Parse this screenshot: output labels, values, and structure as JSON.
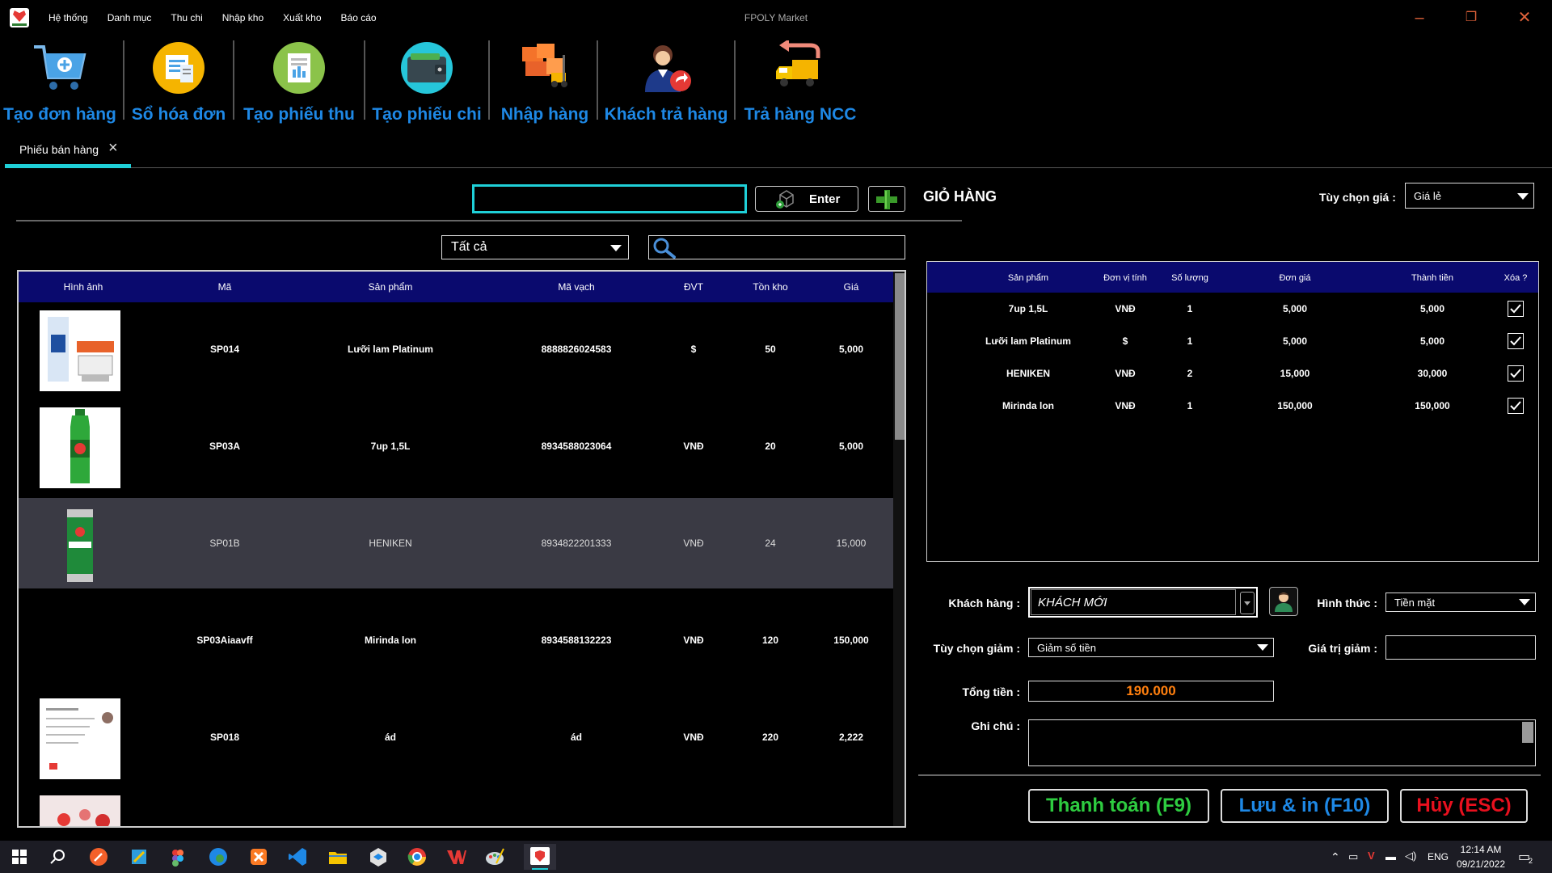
{
  "menu": [
    "Hệ thống",
    "Danh mục",
    "Thu chi",
    "Nhập kho",
    "Xuất kho",
    "Báo cáo"
  ],
  "window_title": "FPOLY Market",
  "window_controls": {
    "minimize": "–",
    "restore": "❐",
    "close": "✕"
  },
  "ribbon": {
    "create_order": "Tạo đơn hàng",
    "invoice_book": "Sổ hóa đơn",
    "create_receipt": "Tạo phiếu thu",
    "create_payment": "Tạo phiếu chi",
    "import_goods": "Nhập hàng",
    "customer_return": "Khách trả hàng",
    "supplier_return": "Trả hàng NCC"
  },
  "tab": {
    "label": "Phiếu bán hàng"
  },
  "barcode": {
    "value": "",
    "enter_label": "Enter"
  },
  "filter": {
    "category": "Tất cả",
    "search_value": ""
  },
  "product_table": {
    "headers": {
      "image": "Hình ảnh",
      "code": "Mã",
      "product": "Sản phẩm",
      "barcode": "Mã vạch",
      "unit": "ĐVT",
      "stock": "Tồn kho",
      "price": "Giá"
    },
    "rows": [
      {
        "code": "SP014",
        "product": "Lưỡi lam Platinum",
        "barcode": "8888826024583",
        "unit": "$",
        "stock": "50",
        "price": "5,000"
      },
      {
        "code": "SP03A",
        "product": "7up 1,5L",
        "barcode": "8934588023064",
        "unit": "VNĐ",
        "stock": "20",
        "price": "5,000"
      },
      {
        "code": "SP01B",
        "product": "HENIKEN",
        "barcode": "8934822201333",
        "unit": "VNĐ",
        "stock": "24",
        "price": "15,000"
      },
      {
        "code": "SP03Aiaavff",
        "product": "Mirinda lon",
        "barcode": "8934588132223",
        "unit": "VNĐ",
        "stock": "120",
        "price": "150,000"
      },
      {
        "code": "SP018",
        "product": "ád",
        "barcode": "ád",
        "unit": "VNĐ",
        "stock": "220",
        "price": "2,222"
      }
    ]
  },
  "cart": {
    "title": "GIỎ HÀNG",
    "price_option_label": "Tùy chọn giá :",
    "price_option": "Giá lẻ",
    "headers": {
      "product": "Sản phẩm",
      "unit": "Đơn vị tính",
      "qty": "Số lượng",
      "unit_price": "Đơn giá",
      "total": "Thành tiền",
      "delete": "Xóa ?"
    },
    "rows": [
      {
        "product": "7up 1,5L",
        "unit": "VNĐ",
        "qty": "1",
        "unit_price": "5,000",
        "total": "5,000"
      },
      {
        "product": "Lưỡi lam Platinum",
        "unit": "$",
        "qty": "1",
        "unit_price": "5,000",
        "total": "5,000"
      },
      {
        "product": "HENIKEN",
        "unit": "VNĐ",
        "qty": "2",
        "unit_price": "15,000",
        "total": "30,000"
      },
      {
        "product": "Mirinda lon",
        "unit": "VNĐ",
        "qty": "1",
        "unit_price": "150,000",
        "total": "150,000"
      }
    ]
  },
  "form": {
    "customer_label": "Khách hàng :",
    "customer_value": "KHÁCH MỚI",
    "payment_method_label": "Hình thức :",
    "payment_method": "Tiền mặt",
    "discount_option_label": "Tùy chọn giảm :",
    "discount_option": "Giảm số tiền",
    "discount_value_label": "Giá trị giảm :",
    "discount_value": "",
    "total_label": "Tổng tiền :",
    "total_value": "190.000",
    "note_label": "Ghi chú :",
    "note_value": ""
  },
  "actions": {
    "pay": "Thanh toán (F9)",
    "save_print": "Lưu & in (F10)",
    "cancel": "Hủy (ESC)"
  },
  "colors": {
    "accent": "#1fd0d8",
    "ribbon_label": "#1e88e5",
    "header_bg": "#0a0a6e",
    "pay": "#2ecc40",
    "save": "#1e88e5",
    "cancel": "#e8101e",
    "total": "#ff7f0e"
  },
  "taskbar": {
    "lang": "ENG",
    "time": "12:14 AM",
    "date": "09/21/2022",
    "notifications": "2"
  }
}
